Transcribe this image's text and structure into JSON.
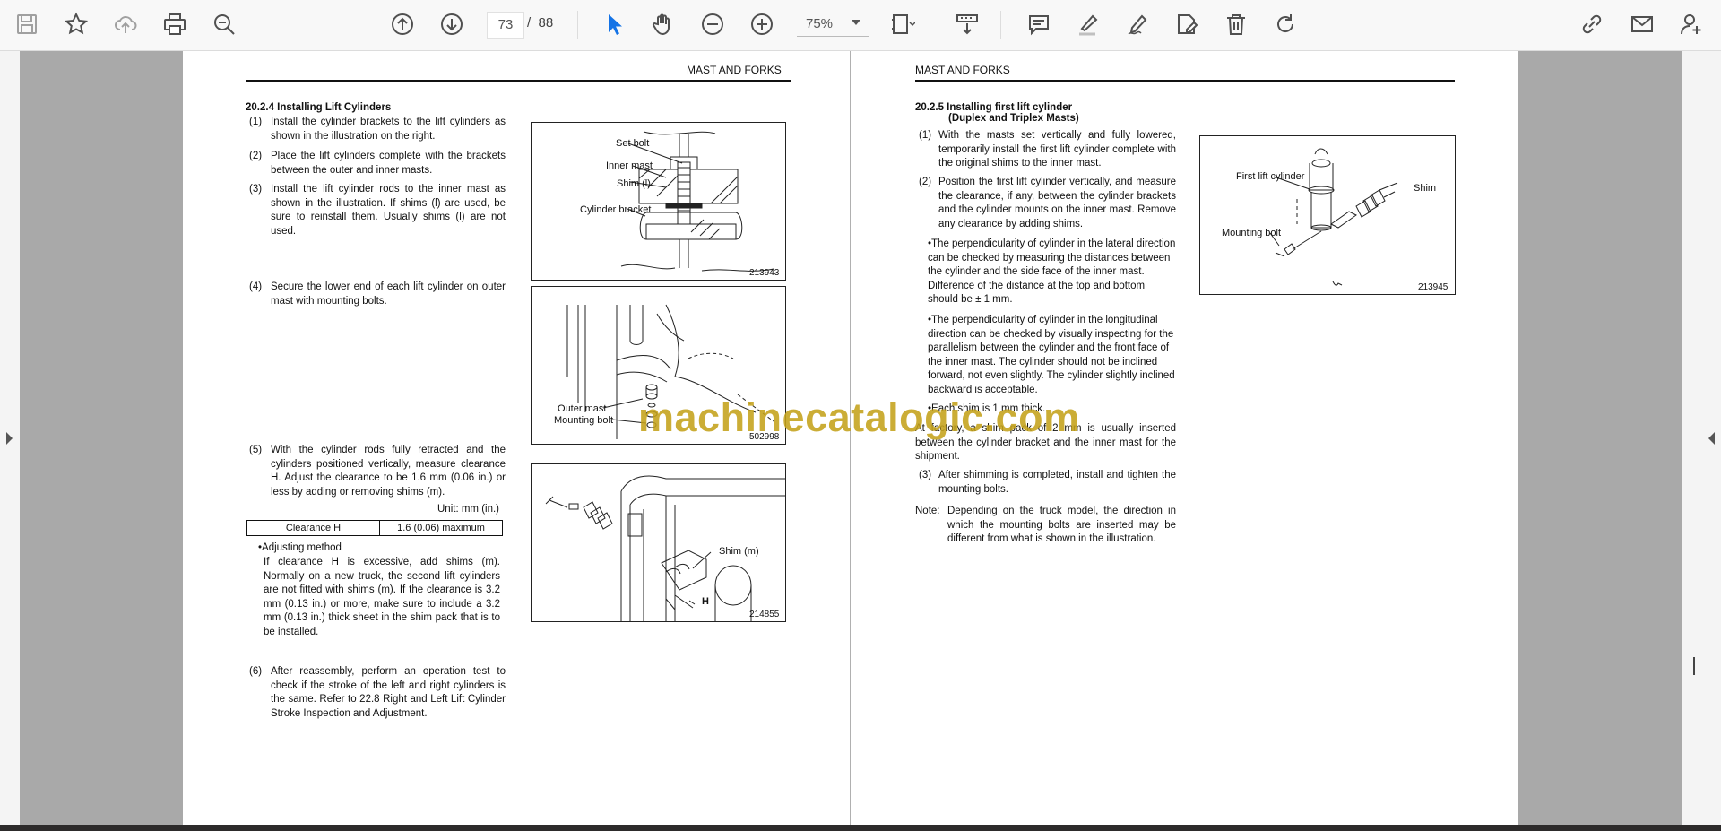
{
  "toolbar": {
    "current_page": "73",
    "page_separator": "/",
    "total_pages": "88",
    "zoom": "75%"
  },
  "left_page": {
    "header": "MAST AND FORKS",
    "section_title": "20.2.4 Installing Lift Cylinders",
    "steps": [
      {
        "num": "(1)",
        "text": "Install the cylinder brackets to the lift cylinders as shown in the illustration on the right."
      },
      {
        "num": "(2)",
        "text": "Place the lift cylinders complete with the brackets between the outer and inner masts."
      },
      {
        "num": "(3)",
        "text": "Install the lift cylinder rods to the inner mast as shown in the illustration. If shims (l) are used, be sure to reinstall them. Usually shims (l) are not used."
      },
      {
        "num": "(4)",
        "text": "Secure the lower end of each lift cylinder on outer mast with mounting bolts."
      },
      {
        "num": "(5)",
        "text": "With the cylinder rods fully retracted and the cylinders positioned vertically, measure clearance H. Adjust the clearance to be 1.6 mm (0.06 in.) or less by adding or removing shims (m)."
      },
      {
        "num": "(6)",
        "text": "After reassembly, perform an operation test to check if the stroke of the left and right cylinders is the same. Refer to 22.8 Right and Left Lift Cylinder Stroke Inspection and Adjustment."
      }
    ],
    "unit_note": "Unit: mm (in.)",
    "table": {
      "label": "Clearance H",
      "value": "1.6 (0.06) maximum"
    },
    "adjusting_title": "•Adjusting method",
    "adjusting_text": "If clearance H is excessive, add shims (m). Normally on a new truck, the second lift cylinders are not fitted with shims (m). If the clearance is 3.2 mm (0.13 in.) or more, make sure to include a 3.2 mm (0.13 in.) thick sheet in the shim pack that is to be installed.",
    "fig1": {
      "labels": [
        "Set bolt",
        "Inner mast",
        "Shim (l)",
        "Cylinder bracket"
      ],
      "number": "213943"
    },
    "fig2": {
      "labels": [
        "Outer mast",
        "Mounting bolt"
      ],
      "number": "502998"
    },
    "fig3": {
      "labels": [
        "Shim (m)",
        "H"
      ],
      "number": "214855"
    }
  },
  "right_page": {
    "header": "MAST AND FORKS",
    "section_title": "20.2.5 Installing first lift cylinder",
    "section_subtitle": "(Duplex and Triplex Masts)",
    "steps": [
      {
        "num": "(1)",
        "text": "With the masts set vertically and fully lowered, temporarily install the first lift cylinder complete with the original shims to the inner mast."
      },
      {
        "num": "(2)",
        "text": "Position the first lift cylinder vertically, and measure the clearance, if any, between the cylinder brackets and the cylinder mounts on the inner mast. Remove any clearance by adding shims."
      }
    ],
    "bullets": [
      "•The perpendicularity of cylinder in the lateral direction can be checked by measuring the distances between the cylinder and the side face of the inner mast. Difference of the distance at the top and bottom should be ± 1 mm.",
      "•The perpendicularity of cylinder in the longitudinal direction can be checked by visually inspecting for the parallelism between the cylinder and the front face of the inner mast. The cylinder should not be inclined forward, not even slightly. The cylinder slightly inclined backward is acceptable.",
      "•Each shim is 1 mm thick."
    ],
    "factory_note": "At factory, a shim pack of 2 mm is usually inserted between the cylinder bracket and the inner mast for the shipment.",
    "step3": {
      "num": "(3)",
      "text": "After shimming is completed, install and tighten the mounting bolts."
    },
    "note_label": "Note:",
    "note_text": "Depending on the truck model, the direction in which the mounting bolts are inserted may be different from what is shown in the illustration.",
    "fig": {
      "labels": [
        "First lift cylinder",
        "Shim",
        "Mounting bolt"
      ],
      "number": "213945"
    }
  },
  "watermark": "machinecatalogic.com",
  "icons": [
    "save-icon",
    "bookmark-star-icon",
    "cloud-upload-icon",
    "print-icon",
    "zoom-search-icon",
    "page-up-icon",
    "page-down-icon",
    "select-cursor-icon",
    "hand-tool-icon",
    "zoom-out-icon",
    "zoom-in-icon",
    "fit-page-icon",
    "scroll-mode-icon",
    "comment-icon",
    "highlight-icon",
    "sign-icon",
    "stamp-icon",
    "delete-icon",
    "rotate-icon",
    "share-link-icon",
    "email-icon",
    "add-user-icon"
  ],
  "colors": {
    "toolbar_bg": "#f8f8f8",
    "accent_blue": "#1473e6",
    "icon_gray": "#505050",
    "watermark": "#c4a21b"
  }
}
